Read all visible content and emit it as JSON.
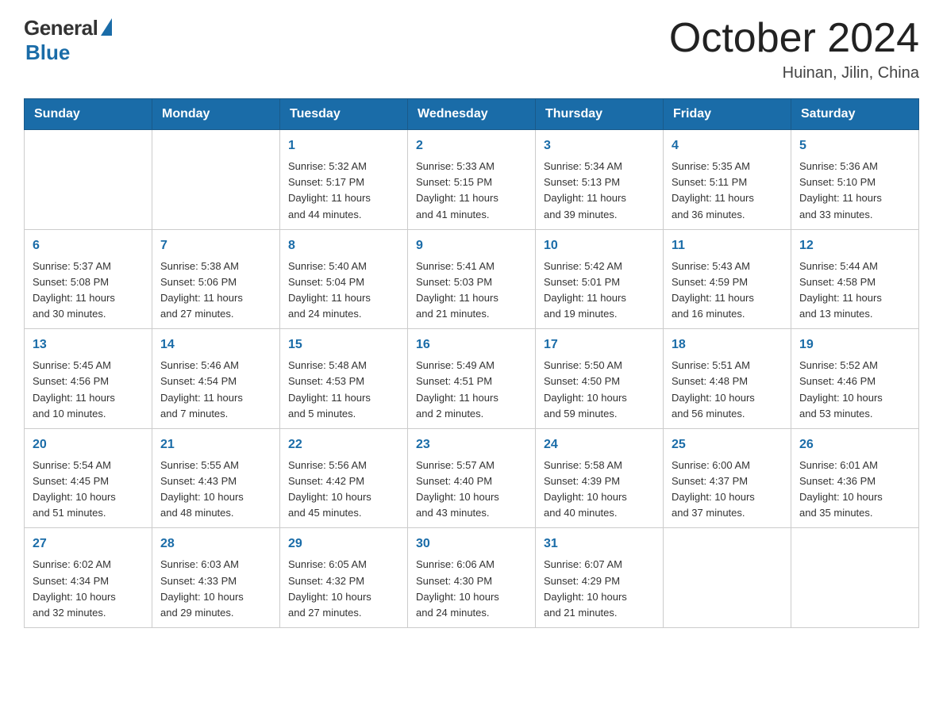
{
  "logo": {
    "general": "General",
    "blue": "Blue"
  },
  "header": {
    "month": "October 2024",
    "location": "Huinan, Jilin, China"
  },
  "weekdays": [
    "Sunday",
    "Monday",
    "Tuesday",
    "Wednesday",
    "Thursday",
    "Friday",
    "Saturday"
  ],
  "weeks": [
    [
      {
        "day": "",
        "info": ""
      },
      {
        "day": "",
        "info": ""
      },
      {
        "day": "1",
        "info": "Sunrise: 5:32 AM\nSunset: 5:17 PM\nDaylight: 11 hours\nand 44 minutes."
      },
      {
        "day": "2",
        "info": "Sunrise: 5:33 AM\nSunset: 5:15 PM\nDaylight: 11 hours\nand 41 minutes."
      },
      {
        "day": "3",
        "info": "Sunrise: 5:34 AM\nSunset: 5:13 PM\nDaylight: 11 hours\nand 39 minutes."
      },
      {
        "day": "4",
        "info": "Sunrise: 5:35 AM\nSunset: 5:11 PM\nDaylight: 11 hours\nand 36 minutes."
      },
      {
        "day": "5",
        "info": "Sunrise: 5:36 AM\nSunset: 5:10 PM\nDaylight: 11 hours\nand 33 minutes."
      }
    ],
    [
      {
        "day": "6",
        "info": "Sunrise: 5:37 AM\nSunset: 5:08 PM\nDaylight: 11 hours\nand 30 minutes."
      },
      {
        "day": "7",
        "info": "Sunrise: 5:38 AM\nSunset: 5:06 PM\nDaylight: 11 hours\nand 27 minutes."
      },
      {
        "day": "8",
        "info": "Sunrise: 5:40 AM\nSunset: 5:04 PM\nDaylight: 11 hours\nand 24 minutes."
      },
      {
        "day": "9",
        "info": "Sunrise: 5:41 AM\nSunset: 5:03 PM\nDaylight: 11 hours\nand 21 minutes."
      },
      {
        "day": "10",
        "info": "Sunrise: 5:42 AM\nSunset: 5:01 PM\nDaylight: 11 hours\nand 19 minutes."
      },
      {
        "day": "11",
        "info": "Sunrise: 5:43 AM\nSunset: 4:59 PM\nDaylight: 11 hours\nand 16 minutes."
      },
      {
        "day": "12",
        "info": "Sunrise: 5:44 AM\nSunset: 4:58 PM\nDaylight: 11 hours\nand 13 minutes."
      }
    ],
    [
      {
        "day": "13",
        "info": "Sunrise: 5:45 AM\nSunset: 4:56 PM\nDaylight: 11 hours\nand 10 minutes."
      },
      {
        "day": "14",
        "info": "Sunrise: 5:46 AM\nSunset: 4:54 PM\nDaylight: 11 hours\nand 7 minutes."
      },
      {
        "day": "15",
        "info": "Sunrise: 5:48 AM\nSunset: 4:53 PM\nDaylight: 11 hours\nand 5 minutes."
      },
      {
        "day": "16",
        "info": "Sunrise: 5:49 AM\nSunset: 4:51 PM\nDaylight: 11 hours\nand 2 minutes."
      },
      {
        "day": "17",
        "info": "Sunrise: 5:50 AM\nSunset: 4:50 PM\nDaylight: 10 hours\nand 59 minutes."
      },
      {
        "day": "18",
        "info": "Sunrise: 5:51 AM\nSunset: 4:48 PM\nDaylight: 10 hours\nand 56 minutes."
      },
      {
        "day": "19",
        "info": "Sunrise: 5:52 AM\nSunset: 4:46 PM\nDaylight: 10 hours\nand 53 minutes."
      }
    ],
    [
      {
        "day": "20",
        "info": "Sunrise: 5:54 AM\nSunset: 4:45 PM\nDaylight: 10 hours\nand 51 minutes."
      },
      {
        "day": "21",
        "info": "Sunrise: 5:55 AM\nSunset: 4:43 PM\nDaylight: 10 hours\nand 48 minutes."
      },
      {
        "day": "22",
        "info": "Sunrise: 5:56 AM\nSunset: 4:42 PM\nDaylight: 10 hours\nand 45 minutes."
      },
      {
        "day": "23",
        "info": "Sunrise: 5:57 AM\nSunset: 4:40 PM\nDaylight: 10 hours\nand 43 minutes."
      },
      {
        "day": "24",
        "info": "Sunrise: 5:58 AM\nSunset: 4:39 PM\nDaylight: 10 hours\nand 40 minutes."
      },
      {
        "day": "25",
        "info": "Sunrise: 6:00 AM\nSunset: 4:37 PM\nDaylight: 10 hours\nand 37 minutes."
      },
      {
        "day": "26",
        "info": "Sunrise: 6:01 AM\nSunset: 4:36 PM\nDaylight: 10 hours\nand 35 minutes."
      }
    ],
    [
      {
        "day": "27",
        "info": "Sunrise: 6:02 AM\nSunset: 4:34 PM\nDaylight: 10 hours\nand 32 minutes."
      },
      {
        "day": "28",
        "info": "Sunrise: 6:03 AM\nSunset: 4:33 PM\nDaylight: 10 hours\nand 29 minutes."
      },
      {
        "day": "29",
        "info": "Sunrise: 6:05 AM\nSunset: 4:32 PM\nDaylight: 10 hours\nand 27 minutes."
      },
      {
        "day": "30",
        "info": "Sunrise: 6:06 AM\nSunset: 4:30 PM\nDaylight: 10 hours\nand 24 minutes."
      },
      {
        "day": "31",
        "info": "Sunrise: 6:07 AM\nSunset: 4:29 PM\nDaylight: 10 hours\nand 21 minutes."
      },
      {
        "day": "",
        "info": ""
      },
      {
        "day": "",
        "info": ""
      }
    ]
  ]
}
